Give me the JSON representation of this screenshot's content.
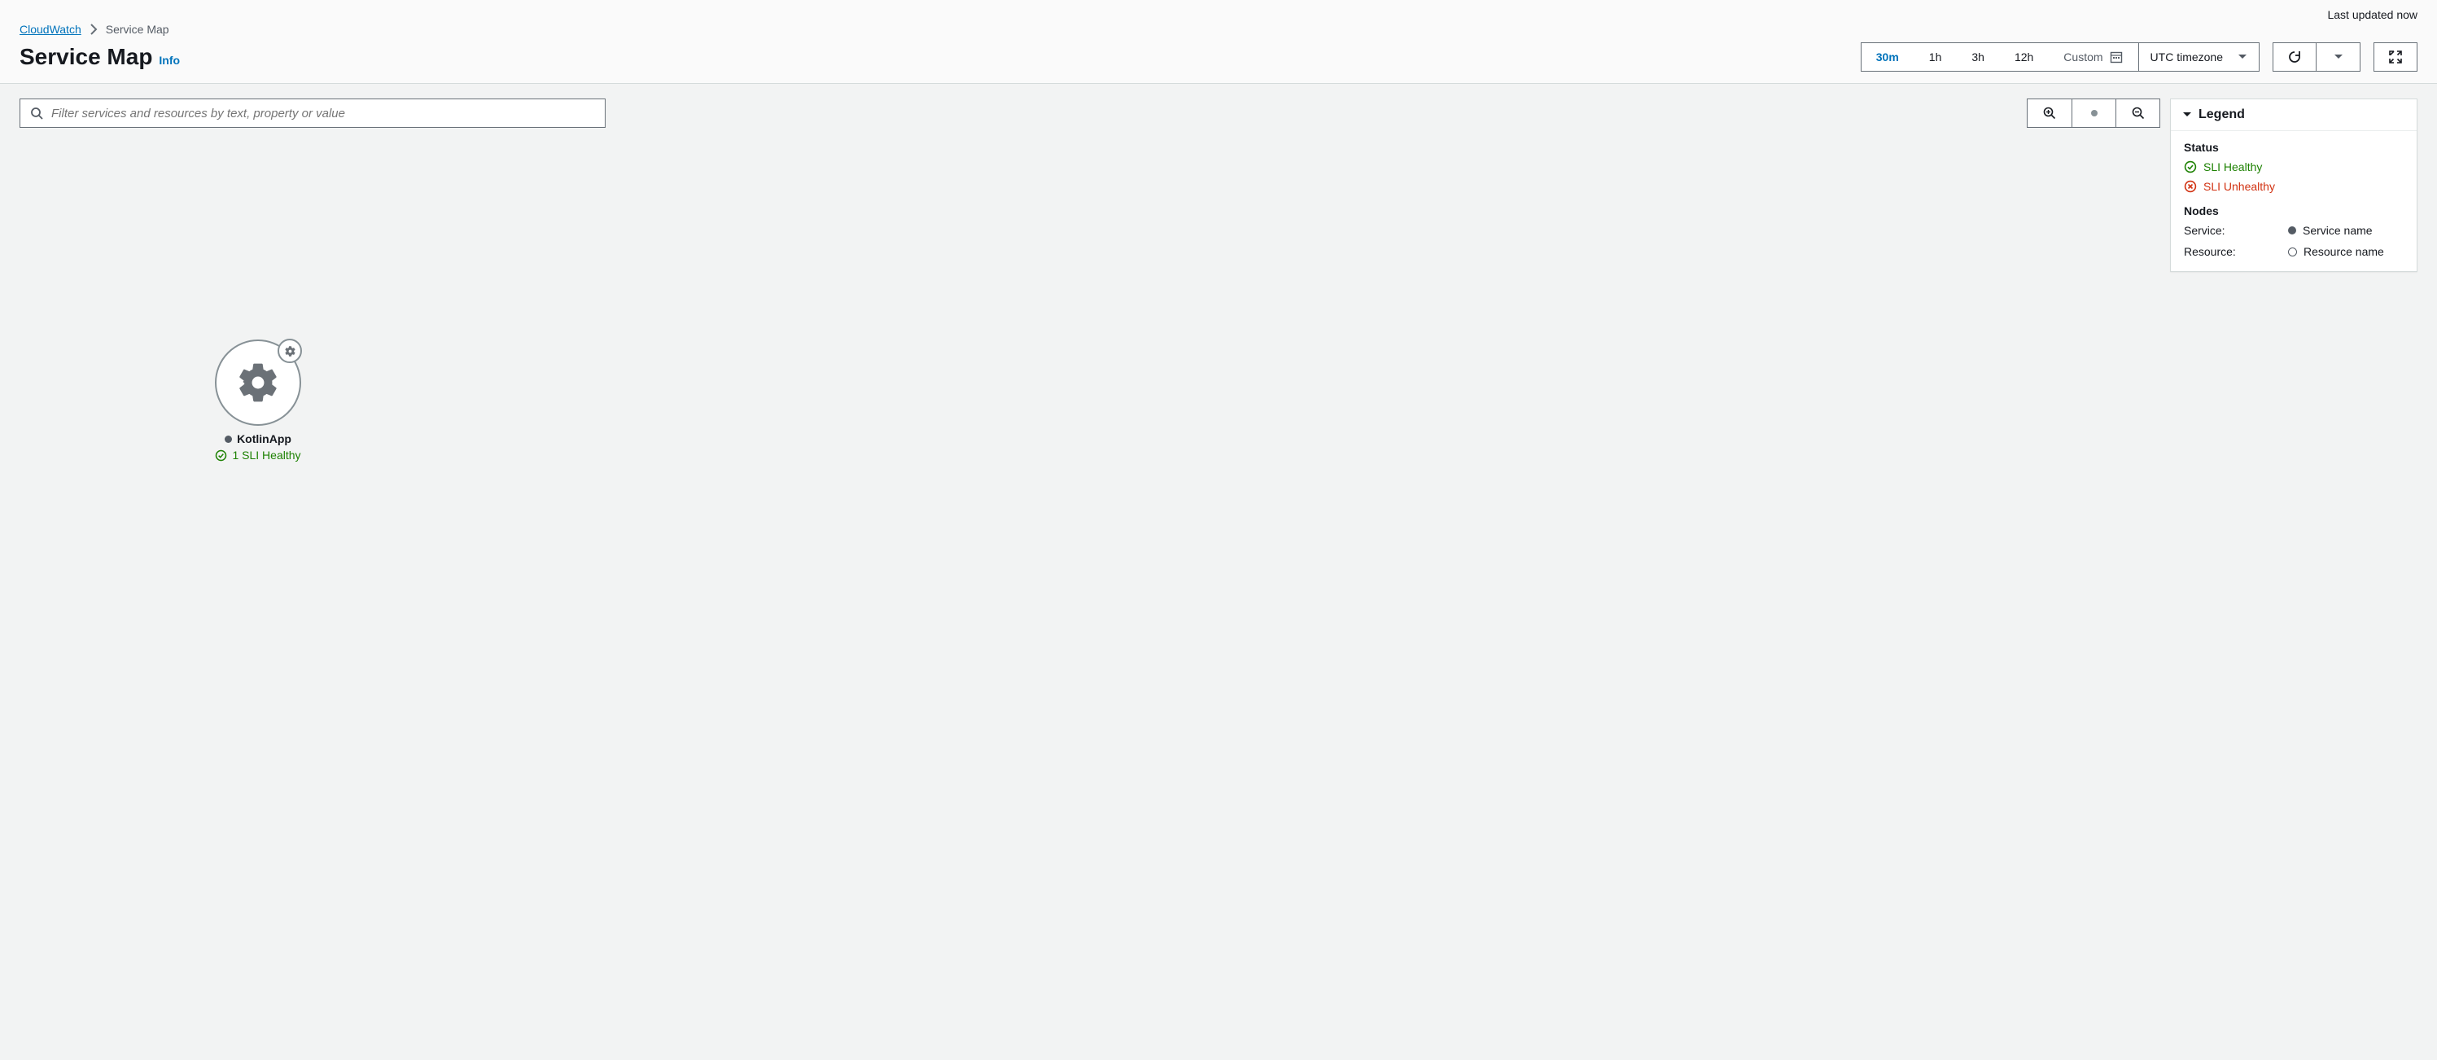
{
  "header": {
    "last_updated": "Last updated now",
    "breadcrumb": {
      "root": "CloudWatch",
      "current": "Service Map"
    },
    "title": "Service Map",
    "info": "Info"
  },
  "time_range": {
    "options": [
      "30m",
      "1h",
      "3h",
      "12h"
    ],
    "active": "30m",
    "custom_label": "Custom",
    "timezone": "UTC timezone"
  },
  "search": {
    "placeholder": "Filter services and resources by text, property or value"
  },
  "legend": {
    "title": "Legend",
    "status_title": "Status",
    "sli_healthy": "SLI Healthy",
    "sli_unhealthy": "SLI Unhealthy",
    "nodes_title": "Nodes",
    "service_label": "Service:",
    "service_value": "Service name",
    "resource_label": "Resource:",
    "resource_value": "Resource name"
  },
  "node": {
    "name": "KotlinApp",
    "status_text": "1 SLI Healthy"
  }
}
